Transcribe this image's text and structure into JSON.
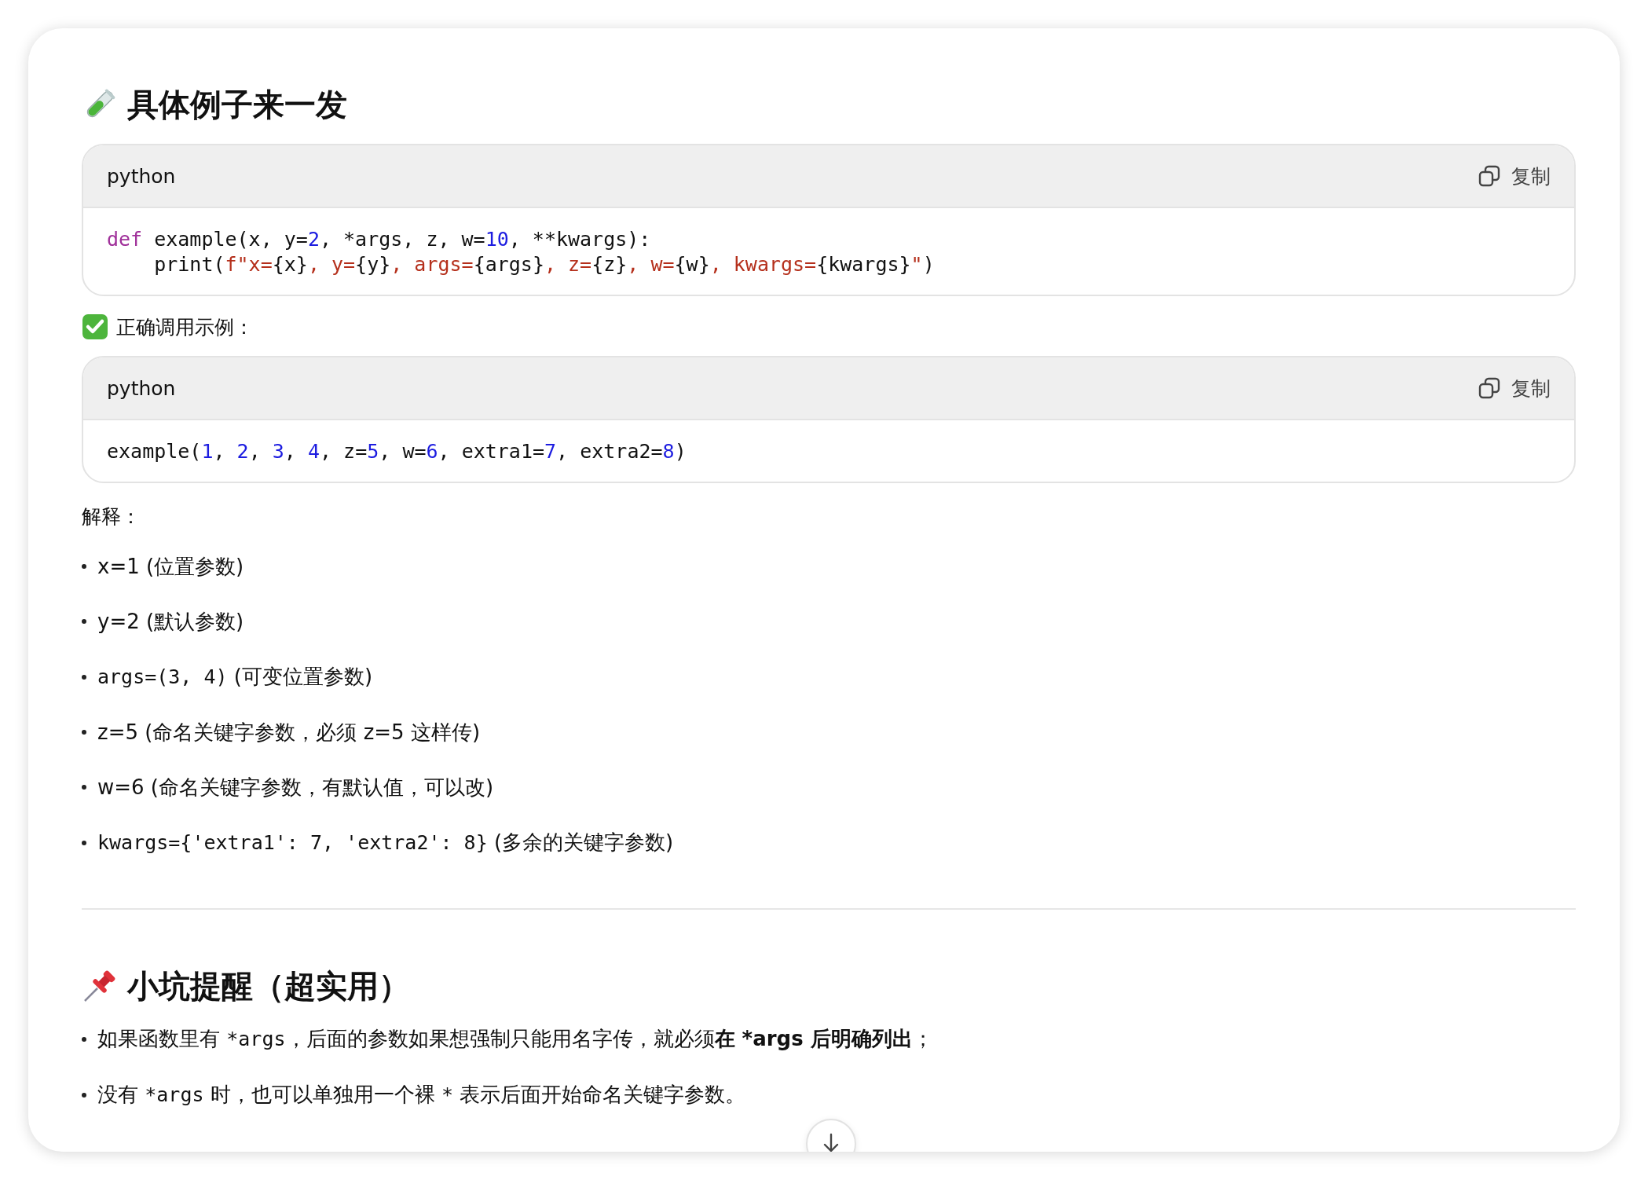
{
  "sections": [
    {
      "kind": "example",
      "heading": "具体例子来一发",
      "blocks": [
        {
          "kind": "code",
          "language": "python",
          "copy_label": "复制",
          "lines": [
            [
              {
                "t": "def",
                "kind": "keyword"
              },
              {
                "t": " example(x, y=",
                "kind": "plain"
              },
              {
                "t": "2",
                "kind": "number"
              },
              {
                "t": ", *args, z, w=",
                "kind": "plain"
              },
              {
                "t": "10",
                "kind": "number"
              },
              {
                "t": ", **kwargs):",
                "kind": "plain"
              }
            ],
            [
              {
                "t": "    print(",
                "kind": "plain"
              },
              {
                "t": "f\"x=",
                "kind": "string"
              },
              {
                "t": "{x}",
                "kind": "plain"
              },
              {
                "t": ", y=",
                "kind": "string"
              },
              {
                "t": "{y}",
                "kind": "plain"
              },
              {
                "t": ", args=",
                "kind": "string"
              },
              {
                "t": "{args}",
                "kind": "plain"
              },
              {
                "t": ", z=",
                "kind": "string"
              },
              {
                "t": "{z}",
                "kind": "plain"
              },
              {
                "t": ", w=",
                "kind": "string"
              },
              {
                "t": "{w}",
                "kind": "plain"
              },
              {
                "t": ", kwargs=",
                "kind": "string"
              },
              {
                "t": "{kwargs}",
                "kind": "plain"
              },
              {
                "t": "\"",
                "kind": "string"
              },
              {
                "t": ")",
                "kind": "plain"
              }
            ]
          ]
        },
        {
          "kind": "check",
          "text": "正确调用示例："
        },
        {
          "kind": "code",
          "language": "python",
          "copy_label": "复制",
          "lines": [
            [
              {
                "t": "example(",
                "kind": "plain"
              },
              {
                "t": "1",
                "kind": "number"
              },
              {
                "t": ", ",
                "kind": "plain"
              },
              {
                "t": "2",
                "kind": "number"
              },
              {
                "t": ", ",
                "kind": "plain"
              },
              {
                "t": "3",
                "kind": "number"
              },
              {
                "t": ", ",
                "kind": "plain"
              },
              {
                "t": "4",
                "kind": "number"
              },
              {
                "t": ", z=",
                "kind": "plain"
              },
              {
                "t": "5",
                "kind": "number"
              },
              {
                "t": ", w=",
                "kind": "plain"
              },
              {
                "t": "6",
                "kind": "number"
              },
              {
                "t": ", extra1=",
                "kind": "plain"
              },
              {
                "t": "7",
                "kind": "number"
              },
              {
                "t": ", extra2=",
                "kind": "plain"
              },
              {
                "t": "8",
                "kind": "number"
              },
              {
                "t": ")",
                "kind": "plain"
              }
            ]
          ]
        },
        {
          "kind": "paragraph",
          "text": "解释："
        },
        {
          "kind": "bullets",
          "items": [
            [
              {
                "t": "x=1 (位置参数)",
                "kind": "text"
              }
            ],
            [
              {
                "t": "y=2 (默认参数)",
                "kind": "text"
              }
            ],
            [
              {
                "t": "args=(3, 4)",
                "kind": "code"
              },
              {
                "t": " (可变位置参数)",
                "kind": "text"
              }
            ],
            [
              {
                "t": "z=5 (命名关键字参数，必须 z=5 这样传)",
                "kind": "text"
              }
            ],
            [
              {
                "t": "w=6 (命名关键字参数，有默认值，可以改)",
                "kind": "text"
              }
            ],
            [
              {
                "t": "kwargs={'extra1': 7, 'extra2': 8}",
                "kind": "code"
              },
              {
                "t": " (多余的关键字参数)",
                "kind": "text"
              }
            ]
          ]
        }
      ]
    },
    {
      "kind": "divider"
    },
    {
      "kind": "tips",
      "heading": "小坑提醒（超实用）",
      "blocks": [
        {
          "kind": "bullets",
          "items": [
            [
              {
                "t": "如果函数里有 ",
                "kind": "text"
              },
              {
                "t": "*args",
                "kind": "code"
              },
              {
                "t": "，后面的参数如果想强制只能用名字传，就必须**在 *args 后明确列出**；",
                "kind": "text"
              }
            ],
            [
              {
                "t": "没有 ",
                "kind": "text"
              },
              {
                "t": "*args",
                "kind": "code"
              },
              {
                "t": " 时，也可以单独用一个裸 ",
                "kind": "text"
              },
              {
                "t": "*",
                "kind": "code"
              },
              {
                "t": " 表示后面开始命名关键字参数。",
                "kind": "text"
              }
            ]
          ]
        }
      ]
    }
  ]
}
